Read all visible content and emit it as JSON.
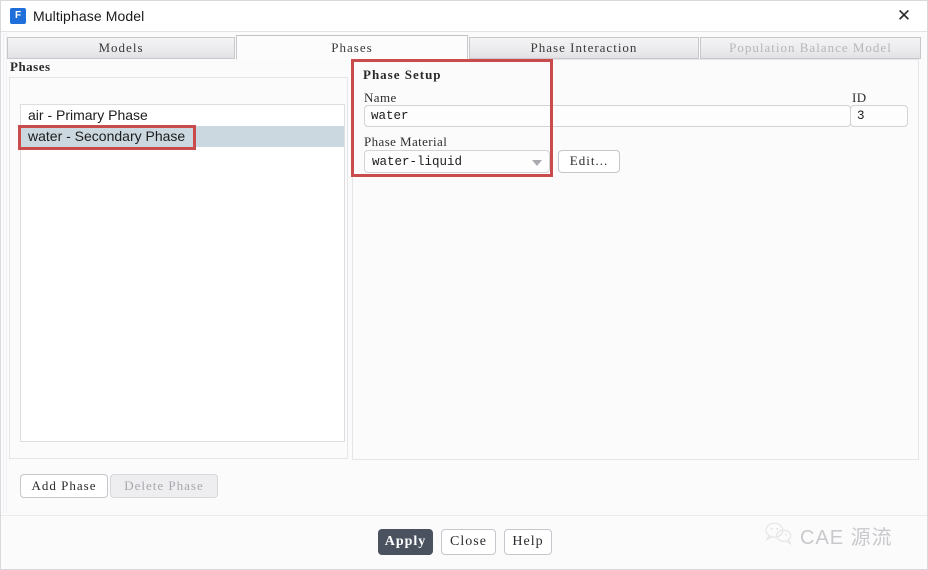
{
  "window": {
    "title": "Multiphase Model",
    "icon": "fluent-f-icon",
    "close_label": "✕"
  },
  "tabs": [
    {
      "id": "models",
      "label": "Models",
      "active": false,
      "disabled": false
    },
    {
      "id": "phases",
      "label": "Phases",
      "active": true,
      "disabled": false
    },
    {
      "id": "interaction",
      "label": "Phase Interaction",
      "active": false,
      "disabled": false
    },
    {
      "id": "population",
      "label": "Population Balance Model",
      "active": false,
      "disabled": true
    }
  ],
  "phases_panel": {
    "title": "Phases",
    "items": [
      {
        "label": "air - Primary Phase",
        "selected": false
      },
      {
        "label": "water - Secondary Phase",
        "selected": true
      }
    ],
    "add_button": "Add Phase",
    "delete_button": "Delete Phase"
  },
  "phase_setup": {
    "group_title": "Phase Setup",
    "name_label": "Name",
    "name_value": "water",
    "name_placeholder": "",
    "id_label": "ID",
    "id_value": "3",
    "material_label": "Phase Material",
    "material_value": "water-liquid",
    "edit_button": "Edit..."
  },
  "footer": {
    "apply": "Apply",
    "close": "Close",
    "help": "Help"
  },
  "watermark": {
    "text": "CAE 源流",
    "icon": "wechat-icon"
  },
  "colors": {
    "accent": "#1e6fd9",
    "annotation": "#c94b4b",
    "selection": "#ccd8df",
    "apply_button": "#4a5260"
  }
}
